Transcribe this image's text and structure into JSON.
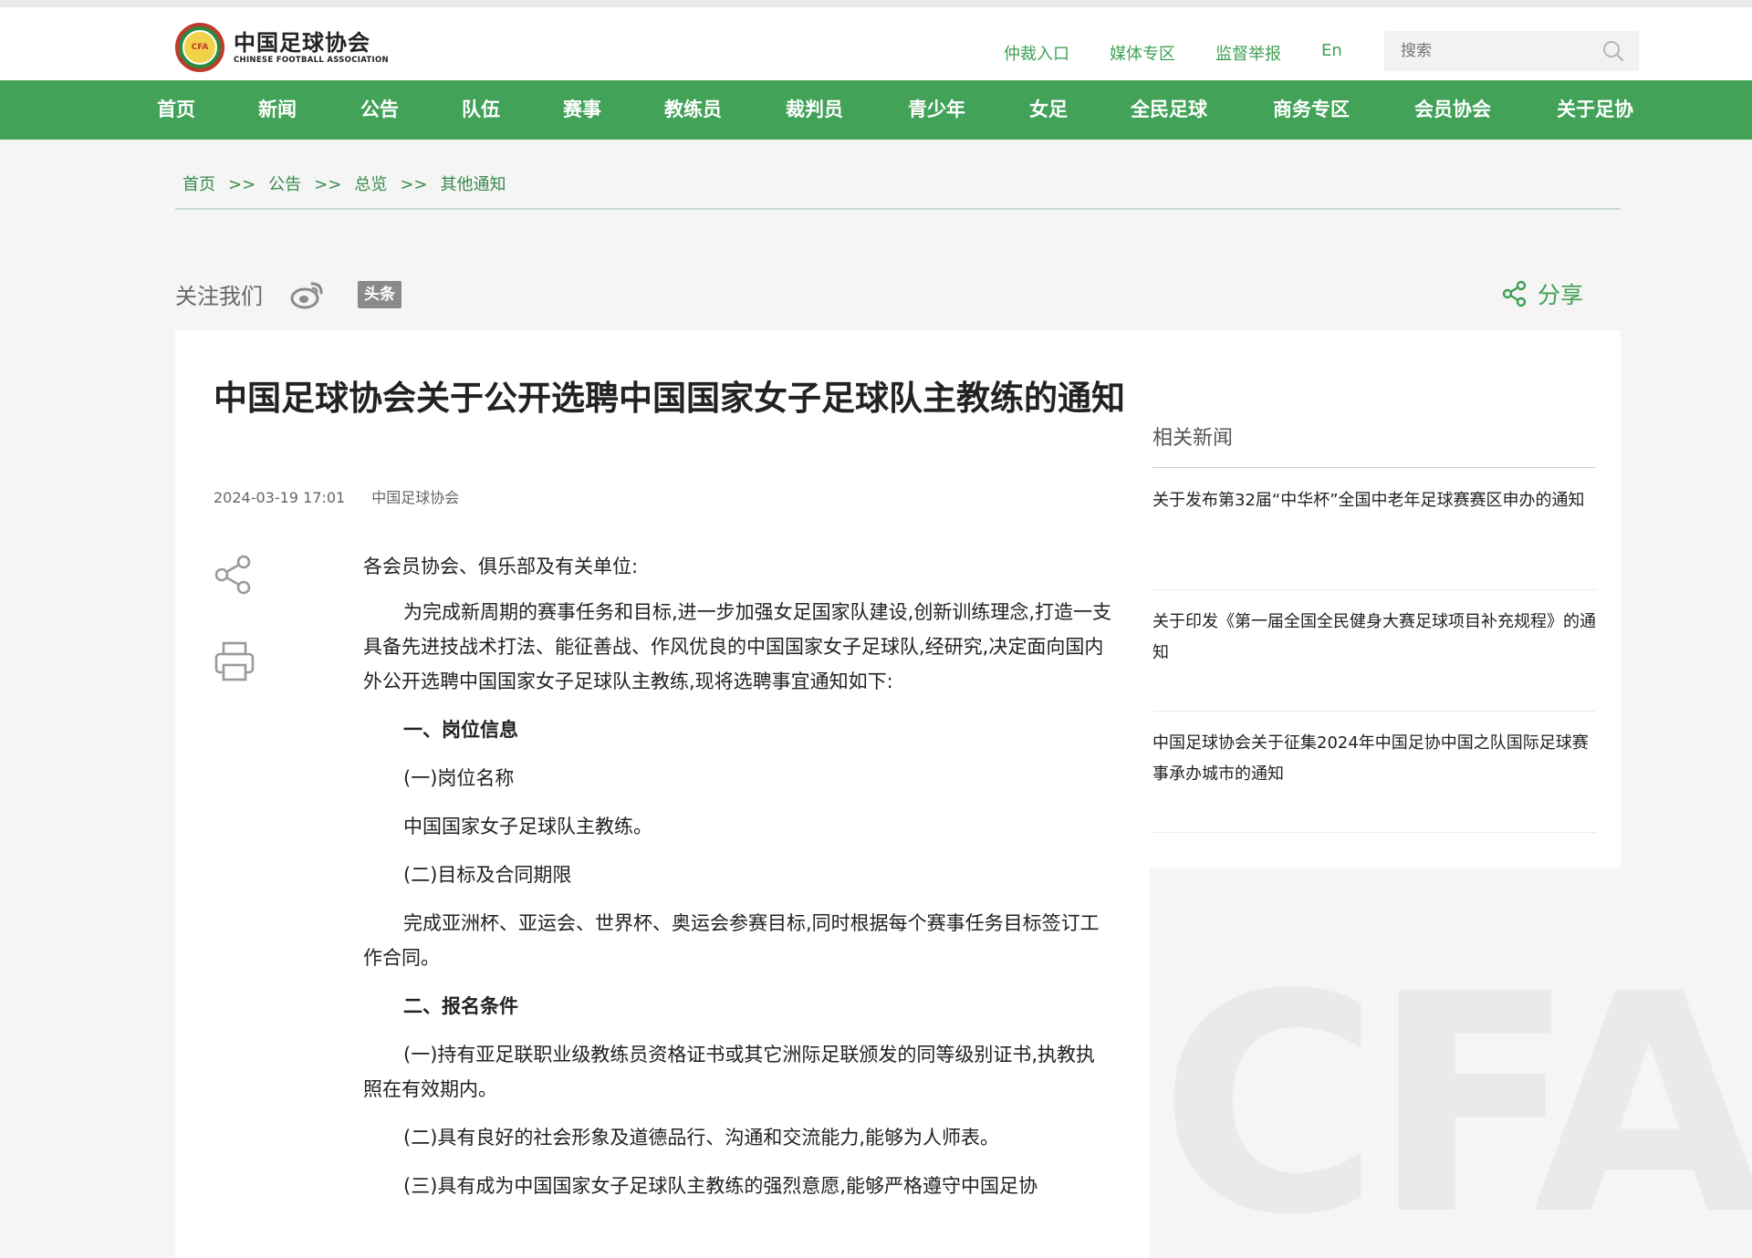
{
  "header": {
    "logo_cn": "中国足球协会",
    "logo_en": "CHINESE FOOTBALL ASSOCIATION",
    "logo_badge": "CFA",
    "links": [
      "仲裁入口",
      "媒体专区",
      "监督举报",
      "En"
    ],
    "search_placeholder": "搜索"
  },
  "nav": [
    "首页",
    "新闻",
    "公告",
    "队伍",
    "赛事",
    "教练员",
    "裁判员",
    "青少年",
    "女足",
    "全民足球",
    "商务专区",
    "会员协会",
    "关于足协"
  ],
  "breadcrumb": [
    "首页",
    "公告",
    "总览",
    "其他通知"
  ],
  "breadcrumb_sep": ">>",
  "follow": {
    "label": "关注我们",
    "toutiao": "头条",
    "share": "分享"
  },
  "article": {
    "title": "中国足球协会关于公开选聘中国国家女子足球队主教练的通知",
    "date": "2024-03-19 17:01",
    "source": "中国足球协会",
    "greeting": "各会员协会、俱乐部及有关单位:",
    "intro": "为完成新周期的赛事任务和目标,进一步加强女足国家队建设,创新训练理念,打造一支具备先进技战术打法、能征善战、作风优良的中国国家女子足球队,经研究,决定面向国内外公开选聘中国国家女子足球队主教练,现将选聘事宜通知如下:",
    "sec1": "一、岗位信息",
    "sec1_sub1": "(一)岗位名称",
    "sec1_sub1_text": "中国国家女子足球队主教练。",
    "sec1_sub2": "(二)目标及合同期限",
    "sec1_sub2_text": "完成亚洲杯、亚运会、世界杯、奥运会参赛目标,同时根据每个赛事任务目标签订工作合同。",
    "sec2": "二、报名条件",
    "sec2_item1": "(一)持有亚足联职业级教练员资格证书或其它洲际足联颁发的同等级别证书,执教执照在有效期内。",
    "sec2_item2": "(二)具有良好的社会形象及道德品行、沟通和交流能力,能够为人师表。",
    "sec2_item3": "(三)具有成为中国国家女子足球队主教练的强烈意愿,能够严格遵守中国足协"
  },
  "related": {
    "title": "相关新闻",
    "items": [
      "关于发布第32届“中华杯”全国中老年足球赛赛区申办的通知",
      "关于印发《第一届全国全民健身大赛足球项目补充规程》的通知",
      "中国足球协会关于征集2024年中国足协中国之队国际足球赛事承办城市的通知"
    ]
  },
  "watermark": "CFA",
  "colors": {
    "brand_green": "#42a258",
    "link_green": "#3fa054"
  }
}
